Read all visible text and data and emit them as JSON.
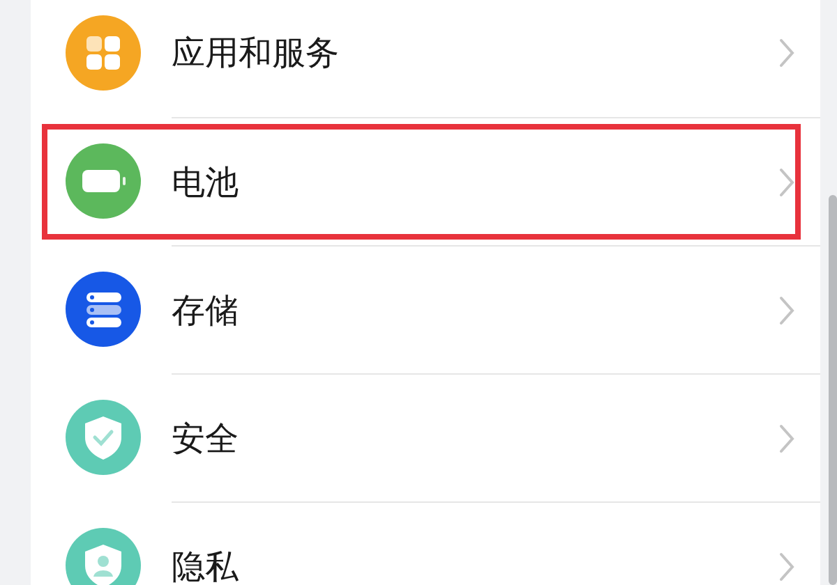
{
  "settings_list": {
    "items": [
      {
        "kind": "apps",
        "label": "应用和服务",
        "highlighted": false
      },
      {
        "kind": "battery",
        "label": "电池",
        "highlighted": true
      },
      {
        "kind": "storage",
        "label": "存储",
        "highlighted": false
      },
      {
        "kind": "security",
        "label": "安全",
        "highlighted": false
      },
      {
        "kind": "privacy",
        "label": "隐私",
        "highlighted": false
      }
    ]
  }
}
